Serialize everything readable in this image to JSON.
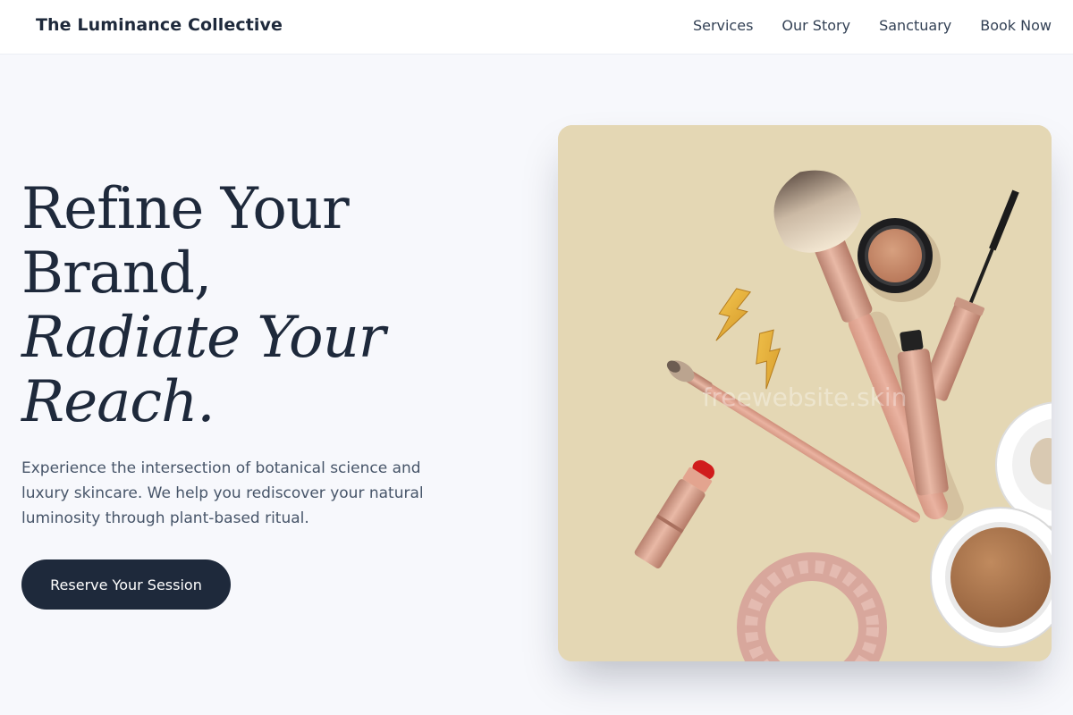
{
  "nav": {
    "brand": "The Luminance Collective",
    "links": [
      "Services",
      "Our Story",
      "Sanctuary",
      "Book Now"
    ]
  },
  "hero": {
    "headline_line1": "Refine Your",
    "headline_line2": "Brand,",
    "headline_line3": "Radiate Your",
    "headline_line4": "Reach.",
    "description": "Experience the intersection of botanical science and luxury skincare. We help you rediscover your natural luminosity through plant-based ritual.",
    "cta_label": "Reserve Your Session",
    "image_watermark": "freewebsite.skin"
  },
  "colors": {
    "navy": "#1e293b",
    "background": "#f7f8fc",
    "image_backdrop": "#e4d7b4",
    "rose_gold": "#d9a08c"
  }
}
